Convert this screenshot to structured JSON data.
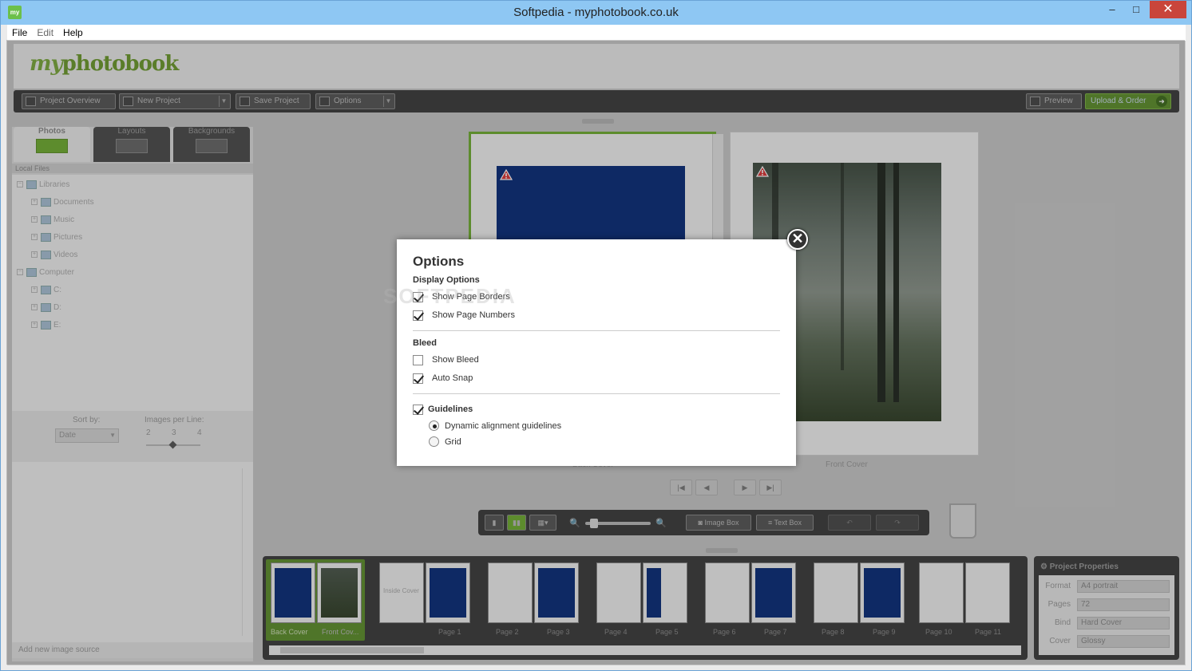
{
  "window": {
    "title": "Softpedia - myphotobook.co.uk",
    "app_icon": "my",
    "minimize": "–",
    "maximize": "□",
    "close": "✕"
  },
  "menu": {
    "file": "File",
    "edit": "Edit",
    "help": "Help"
  },
  "logo": {
    "my": "my",
    "rest": "photobook"
  },
  "toolbar": {
    "project_overview": "Project Overview",
    "new_project": "New Project",
    "save_project": "Save Project",
    "options": "Options",
    "preview": "Preview",
    "upload_order": "Upload & Order"
  },
  "left_tabs": {
    "photos": "Photos",
    "layouts": "Layouts",
    "backgrounds": "Backgrounds"
  },
  "local_files": "Local Files",
  "tree": {
    "libraries": "Libraries",
    "documents": "Documents",
    "music": "Music",
    "pictures": "Pictures",
    "videos": "Videos",
    "computer": "Computer",
    "c": "C:",
    "d": "D:",
    "e": "E:"
  },
  "sort": {
    "label": "Sort by:",
    "value": "Date",
    "per_line_label": "Images per Line:",
    "ticks": [
      "2",
      "3",
      "4"
    ]
  },
  "add_source": "Add new image source",
  "canvas": {
    "back_label": "Back Cover",
    "front_label": "Front Cover"
  },
  "tools": {
    "image_box": "Image Box",
    "text_box": "Text Box"
  },
  "filmstrip": {
    "labels": [
      "Back Cover",
      "Front Cov...",
      "Page 1",
      "Page 2",
      "Page 3",
      "Page 4",
      "Page 5",
      "Page 6",
      "Page 7",
      "Page 8",
      "Page 9",
      "Page 10",
      "Page 11"
    ],
    "inside_cover": "Inside Cover"
  },
  "project_properties": {
    "title": "Project Properties",
    "format_label": "Format",
    "format_value": "A4 portrait",
    "pages_label": "Pages",
    "pages_value": "72",
    "bind_label": "Bind",
    "bind_value": "Hard Cover",
    "cover_label": "Cover",
    "cover_value": "Glossy"
  },
  "dialog": {
    "title": "Options",
    "display_options": "Display Options",
    "show_page_borders": "Show Page Borders",
    "show_page_numbers": "Show Page Numbers",
    "bleed": "Bleed",
    "show_bleed": "Show Bleed",
    "auto_snap": "Auto Snap",
    "guidelines": "Guidelines",
    "dynamic_alignment": "Dynamic alignment guidelines",
    "grid": "Grid",
    "close": "✕"
  },
  "watermark": "SOFTPEDIA"
}
